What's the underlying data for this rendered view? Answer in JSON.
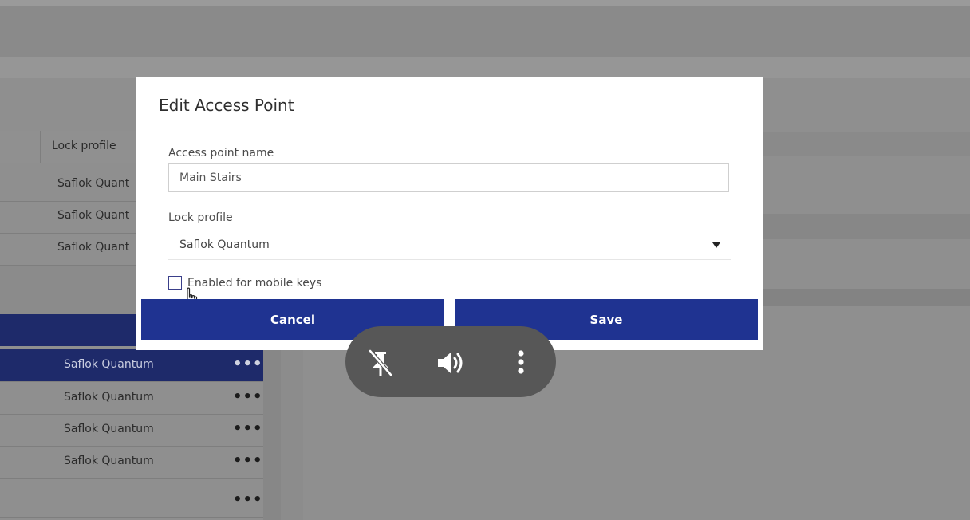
{
  "background": {
    "column_header": "Lock profile",
    "top_rows": [
      "Saflok Quant",
      "Saflok Quant",
      "Saflok Quant"
    ],
    "list_rows": [
      {
        "label": "Saflok Quantum",
        "selected": true
      },
      {
        "label": "Saflok Quantum",
        "selected": false
      },
      {
        "label": "Saflok Quantum",
        "selected": false
      },
      {
        "label": "Saflok Quantum",
        "selected": false
      },
      {
        "label": "",
        "selected": false
      }
    ],
    "more_glyph": "•••"
  },
  "dialog": {
    "title": "Edit Access Point",
    "name_label": "Access point name",
    "name_value": "Main Stairs",
    "lock_label": "Lock profile",
    "lock_value": "Saflok Quantum",
    "mobile_keys_label": "Enabled for mobile keys",
    "mobile_keys_checked": false,
    "cancel_label": "Cancel",
    "save_label": "Save",
    "accent_color": "#1f3391"
  },
  "media_controls": {
    "icons": [
      "pin-off-icon",
      "volume-icon",
      "more-vertical-icon"
    ]
  }
}
